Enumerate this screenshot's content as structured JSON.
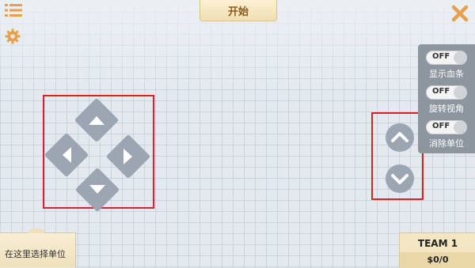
{
  "header": {
    "start_label": "开始"
  },
  "icons": {
    "menu": "menu-list-icon",
    "close": "close-x-icon",
    "settings": "gear-icon",
    "dpad_up": "arrow-up-icon",
    "dpad_left": "arrow-left-icon",
    "dpad_right": "arrow-right-icon",
    "dpad_down": "arrow-down-icon",
    "camera_up": "chevron-up-icon",
    "camera_down": "chevron-down-icon"
  },
  "colors": {
    "accent_orange": "#e8a04a",
    "button_gray": "#9ba6b2",
    "highlight_red": "#e02020",
    "start_text": "#8b5a1e"
  },
  "toggles": [
    {
      "state": "OFF",
      "label": "显示血条"
    },
    {
      "state": "OFF",
      "label": "旋转视角"
    },
    {
      "state": "OFF",
      "label": "消除单位"
    }
  ],
  "unit_select": {
    "label": "在这里选择单位"
  },
  "team": {
    "name": "TEAM 1",
    "money": "$0/0"
  }
}
